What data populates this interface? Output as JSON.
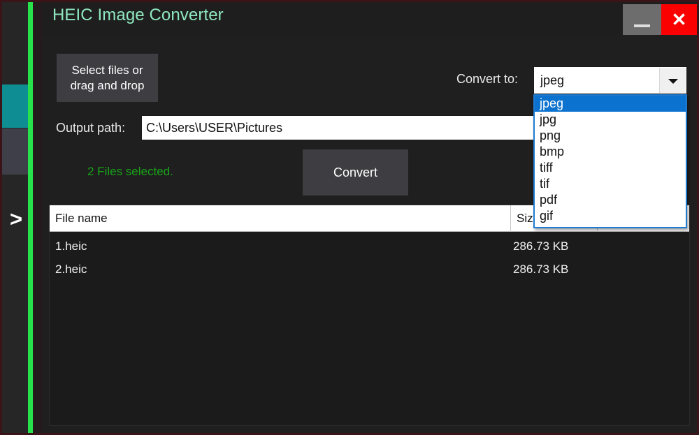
{
  "window": {
    "title": "HEIC Image Converter",
    "minimize_label": "",
    "close_label": "✕"
  },
  "rail": {
    "chevron_label": ">",
    "teal_color": "#0e8e92",
    "gray_color": "#3f3f49",
    "accent_bar_color": "#27e24a"
  },
  "toolbar": {
    "select_files_line1": "Select files or",
    "select_files_line2": "drag and drop",
    "convert_to_label": "Convert to:",
    "convert_button_label": "Convert"
  },
  "combo": {
    "selected_value": "jpeg",
    "arrow_icon": "chevron-down-icon",
    "options": [
      {
        "label": "jpeg",
        "selected": true
      },
      {
        "label": "jpg",
        "selected": false
      },
      {
        "label": "png",
        "selected": false
      },
      {
        "label": "bmp",
        "selected": false
      },
      {
        "label": "tiff",
        "selected": false
      },
      {
        "label": "tif",
        "selected": false
      },
      {
        "label": "pdf",
        "selected": false
      },
      {
        "label": "gif",
        "selected": false
      }
    ],
    "highlight_color": "#0b72cf",
    "border_color": "#1f7ad1"
  },
  "output": {
    "label": "Output path:",
    "value": "C:\\Users\\USER\\Pictures",
    "placeholder": ""
  },
  "status": {
    "text": "2 Files selected.",
    "color": "#18a418"
  },
  "file_list": {
    "columns": [
      "File name",
      "Size",
      ""
    ],
    "rows": [
      {
        "name": "1.heic",
        "size": "286.73 KB"
      },
      {
        "name": "2.heic",
        "size": "286.73 KB"
      }
    ]
  }
}
